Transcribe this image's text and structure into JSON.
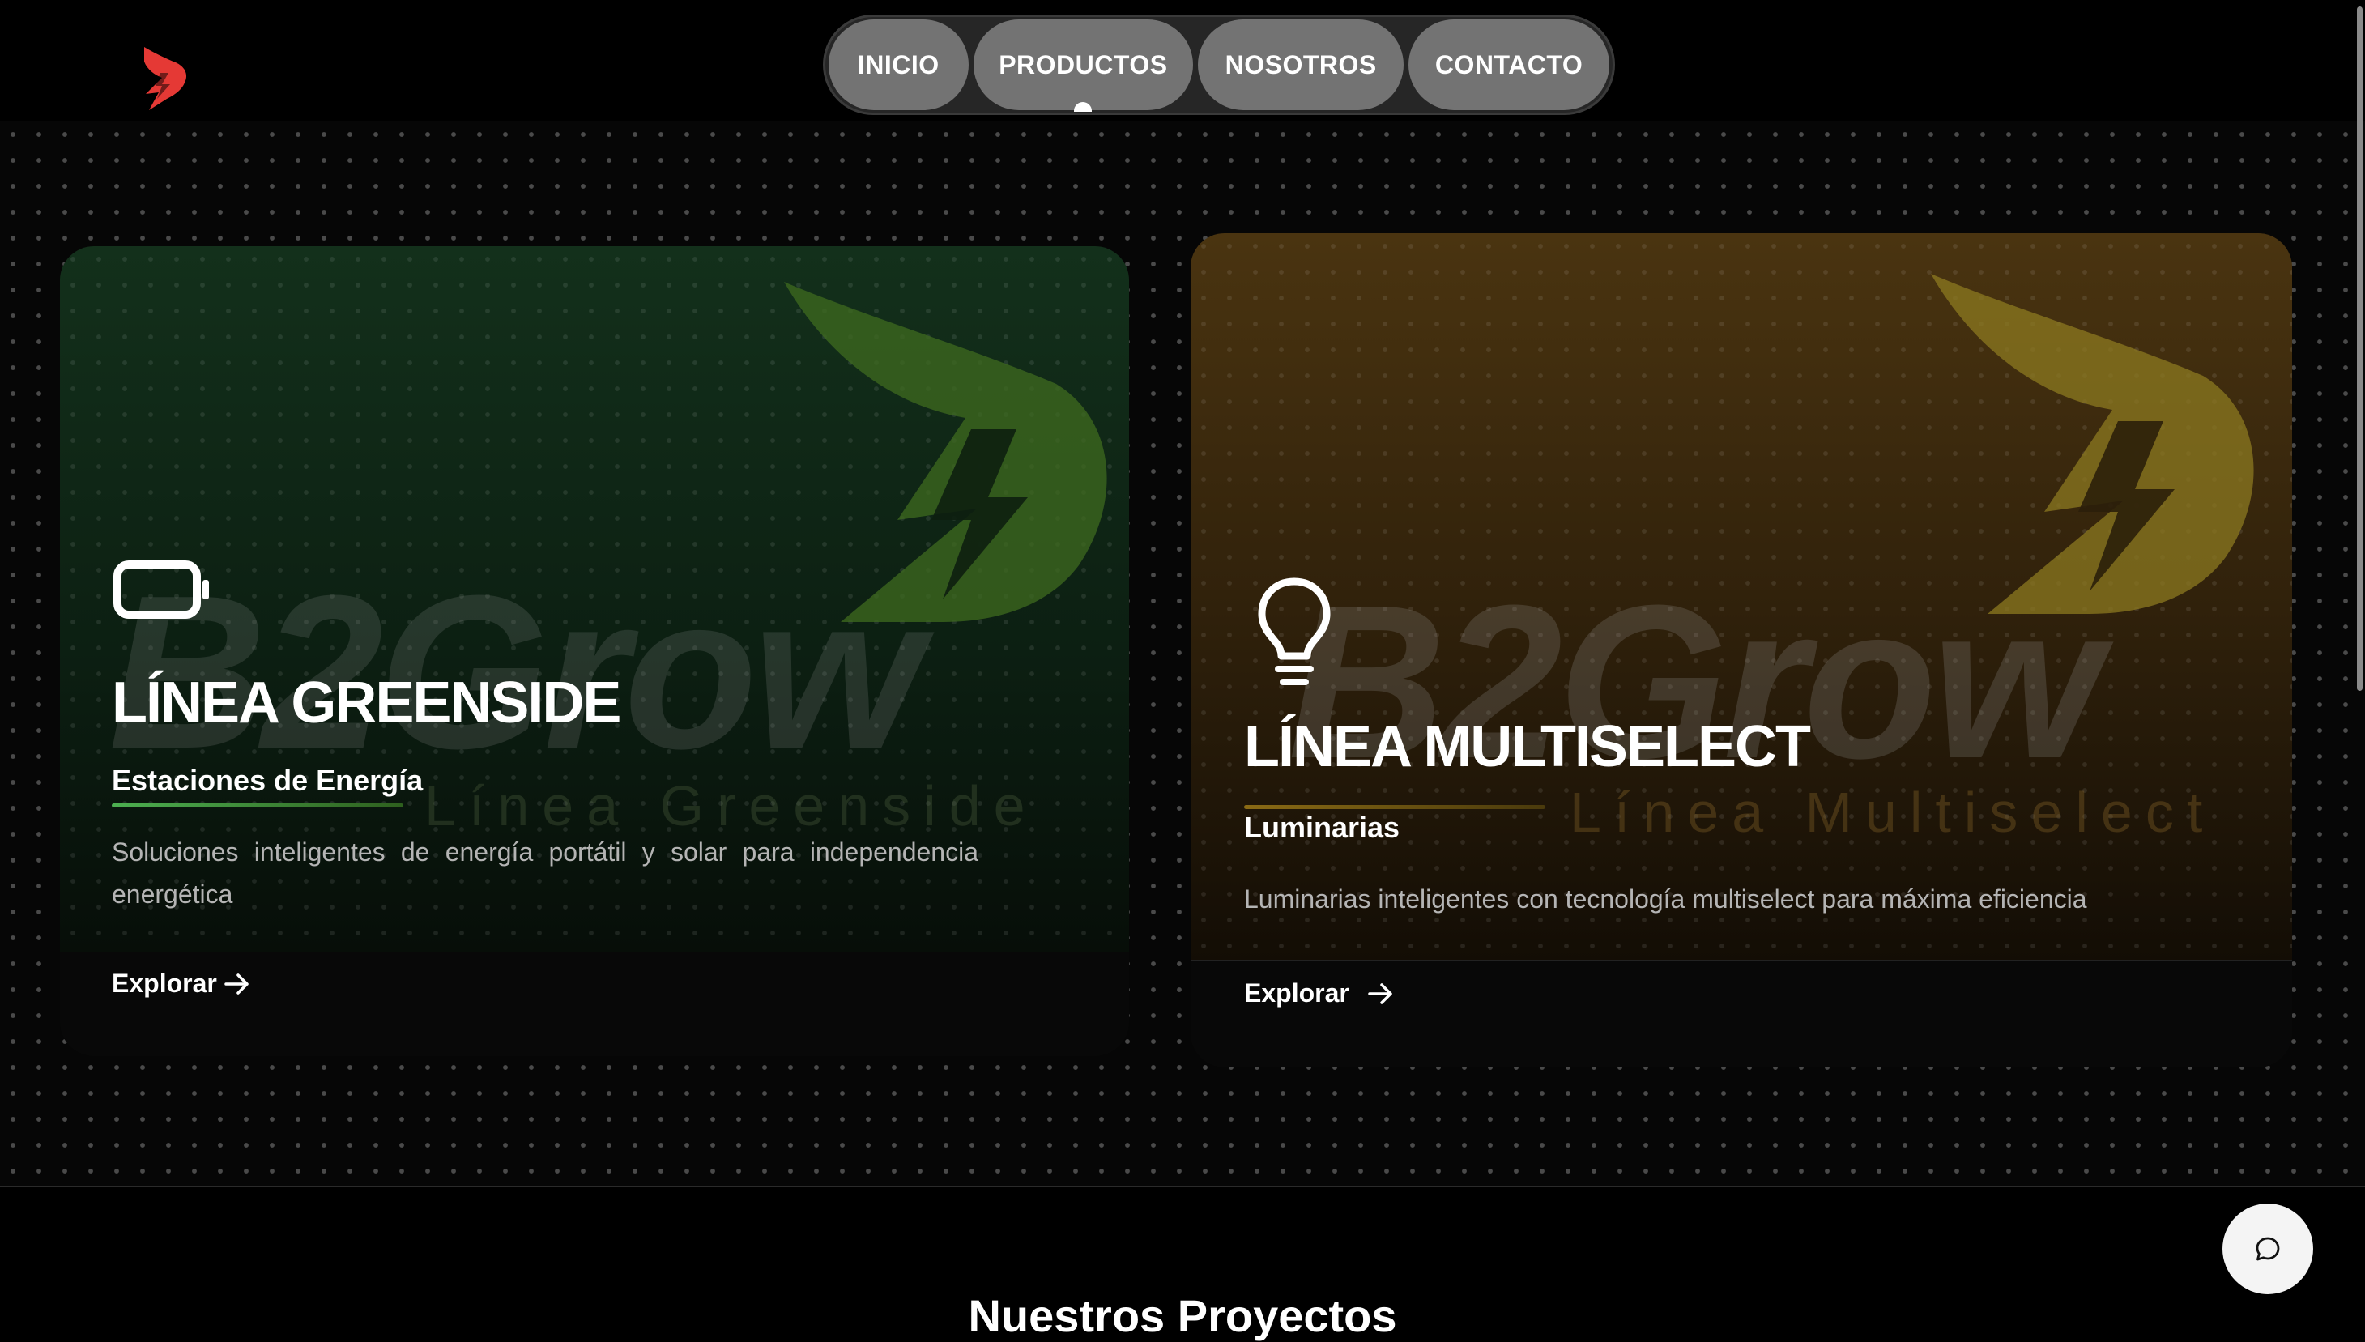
{
  "header": {
    "logo_icon": "brand-wing-logo",
    "nav": [
      {
        "label": "INICIO",
        "active": false
      },
      {
        "label": "PRODUCTOS",
        "active": true
      },
      {
        "label": "NOSOTROS",
        "active": false
      },
      {
        "label": "CONTACTO",
        "active": false
      }
    ]
  },
  "products": [
    {
      "icon": "battery-icon",
      "watermark_brand": "B2Grow",
      "watermark_line": "Línea Greenside",
      "title": "LÍNEA GREENSIDE",
      "subtitle": "Estaciones de Energía",
      "description": "Soluciones inteligentes de energía portátil y solar para independencia energética",
      "cta": "Explorar",
      "accent_color": "#2e7d32"
    },
    {
      "icon": "lightbulb-icon",
      "watermark_brand": "B2Grow",
      "watermark_line": "Línea Multiselect",
      "title": "LÍNEA MULTISELECT",
      "subtitle": "Luminarias",
      "description": "Luminarias inteligentes con tecnología multiselect para máxima eficiencia",
      "cta": "Explorar",
      "accent_color": "#8a6a14"
    }
  ],
  "next_section": {
    "title": "Nuestros Proyectos"
  },
  "chat": {
    "icon": "chat-bubble-icon"
  },
  "colors": {
    "brand_red": "#e53935",
    "background": "#000000",
    "nav_pill": "#737373"
  }
}
